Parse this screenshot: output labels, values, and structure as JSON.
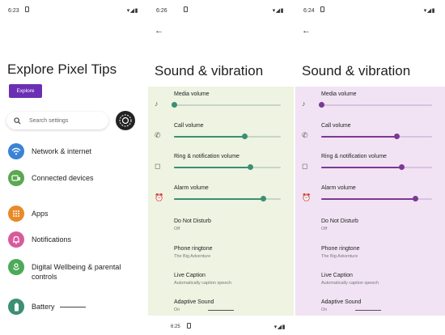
{
  "screens": [
    {
      "status": {
        "time": "6:23",
        "icons": "▾◢▮"
      },
      "title": "Explore Pixel Tips",
      "explore_label": "Explore",
      "search_placeholder": "Search settings",
      "items": [
        {
          "label": "Network & internet",
          "icon": "wifi-icon",
          "color": "#3b82d6"
        },
        {
          "label": "Connected devices",
          "icon": "devices-icon",
          "color": "#5aa84f"
        },
        {
          "label": "Apps",
          "icon": "apps-icon",
          "color": "#e88a2a"
        },
        {
          "label": "Notifications",
          "icon": "bell-icon",
          "color": "#d85a9e"
        },
        {
          "label": "Digital Wellbeing & parental controls",
          "icon": "wellbeing-icon",
          "color": "#4caa58"
        },
        {
          "label": "Battery",
          "icon": "battery-icon",
          "color": "#3b8f75"
        }
      ]
    },
    {
      "status": {
        "time": "6:26",
        "icons": "▾◢▮"
      },
      "title": "Sound & vibration",
      "accent": "#3b8f75",
      "panel_bg": "#eef3e2",
      "sliders": [
        {
          "label": "Media volume",
          "icon": "music-note-icon",
          "value": 0.0
        },
        {
          "label": "Call volume",
          "icon": "phone-icon",
          "value": 0.66
        },
        {
          "label": "Ring & notification volume",
          "icon": "bell-icon",
          "value": 0.71
        },
        {
          "label": "Alarm volume",
          "icon": "alarm-icon",
          "value": 0.83
        }
      ],
      "settings": [
        {
          "label": "Do Not Disturb",
          "sub": "Off"
        },
        {
          "label": "Phone ringtone",
          "sub": "The Big Adventure"
        },
        {
          "label": "Live Caption",
          "sub": "Automatically caption speech"
        },
        {
          "label": "Adaptive Sound",
          "sub": "On"
        }
      ]
    },
    {
      "status": {
        "time": "6:24",
        "icons": "▾◢▮"
      },
      "title": "Sound & vibration",
      "accent": "#7b3a92",
      "panel_bg": "#f1e3f4",
      "sliders": [
        {
          "label": "Media volume",
          "icon": "music-note-icon",
          "value": 0.0
        },
        {
          "label": "Call volume",
          "icon": "phone-icon",
          "value": 0.68
        },
        {
          "label": "Ring & notification volume",
          "icon": "bell-icon",
          "value": 0.72
        },
        {
          "label": "Alarm volume",
          "icon": "alarm-icon",
          "value": 0.85
        }
      ],
      "settings": [
        {
          "label": "Do Not Disturb",
          "sub": "Off"
        },
        {
          "label": "Phone ringtone",
          "sub": "The Big Adventure"
        },
        {
          "label": "Live Caption",
          "sub": "Automatically caption speech"
        },
        {
          "label": "Adaptive Sound",
          "sub": "On"
        }
      ]
    }
  ],
  "bottom_status": {
    "time": "6:25",
    "icons": "▾◢▮"
  }
}
